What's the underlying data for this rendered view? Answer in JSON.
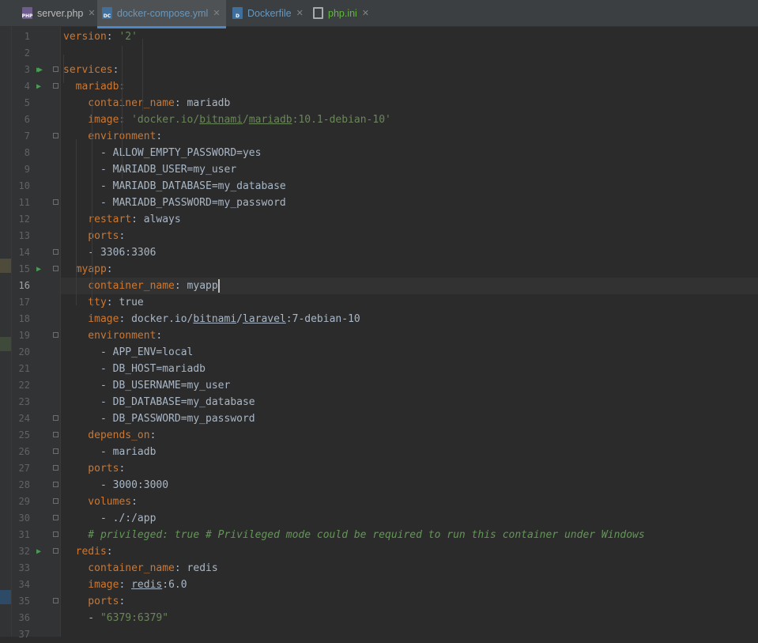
{
  "tabs": [
    {
      "label": "server.php",
      "icon": "php-file-icon",
      "icon_text": "PHP",
      "color": "#bbbbbb",
      "active": false
    },
    {
      "label": "docker-compose.yml",
      "icon": "docker-compose-file-icon",
      "icon_text": "DC",
      "color": "#6897bb",
      "active": true
    },
    {
      "label": "Dockerfile",
      "icon": "dockerfile-icon",
      "icon_text": "D",
      "color": "#6897bb",
      "active": false
    },
    {
      "label": "php.ini",
      "icon": "ini-file-icon",
      "icon_text": "",
      "color": "#62b543",
      "active": false
    }
  ],
  "close_glyph": "✕",
  "run_glyph": "▶",
  "colors": {
    "keyword": "#cc7832",
    "string": "#6a8759",
    "comment": "#629755",
    "text": "#a9b7c6",
    "accent": "#4a88c7"
  },
  "current_line": 16,
  "lines": [
    {
      "n": "1",
      "tokens": [
        {
          "t": "version",
          "c": "k"
        },
        {
          "t": ": ",
          "c": "v"
        },
        {
          "t": "'2'",
          "c": "s"
        }
      ]
    },
    {
      "n": "2",
      "tokens": []
    },
    {
      "n": "3",
      "run": "double",
      "tokens": [
        {
          "t": "services",
          "c": "k"
        },
        {
          "t": ":",
          "c": "v"
        }
      ]
    },
    {
      "n": "4",
      "run": "single",
      "tokens": [
        {
          "t": "  mariadb",
          "c": "k"
        },
        {
          "t": ":",
          "c": "v"
        }
      ]
    },
    {
      "n": "5",
      "tokens": [
        {
          "t": "    container_name",
          "c": "k"
        },
        {
          "t": ": mariadb",
          "c": "v"
        }
      ]
    },
    {
      "n": "6",
      "tokens": [
        {
          "t": "    image",
          "c": "k"
        },
        {
          "t": ": ",
          "c": "v"
        },
        {
          "t": "'docker.io/",
          "c": "s"
        },
        {
          "t": "bitnami",
          "c": "s u"
        },
        {
          "t": "/",
          "c": "s"
        },
        {
          "t": "mariadb",
          "c": "s u"
        },
        {
          "t": ":10.1-debian-10'",
          "c": "s"
        }
      ]
    },
    {
      "n": "7",
      "tokens": [
        {
          "t": "    environment",
          "c": "k"
        },
        {
          "t": ":",
          "c": "v"
        }
      ]
    },
    {
      "n": "8",
      "tokens": [
        {
          "t": "      - ALLOW_EMPTY_PASSWORD=yes",
          "c": "v"
        }
      ]
    },
    {
      "n": "9",
      "tokens": [
        {
          "t": "      - MARIADB_USER=my_user",
          "c": "v"
        }
      ]
    },
    {
      "n": "10",
      "tokens": [
        {
          "t": "      - MARIADB_DATABASE=my_database",
          "c": "v"
        }
      ]
    },
    {
      "n": "11",
      "tokens": [
        {
          "t": "      - MARIADB_PASSWORD=my_password",
          "c": "v"
        }
      ]
    },
    {
      "n": "12",
      "tokens": [
        {
          "t": "    restart",
          "c": "k"
        },
        {
          "t": ": always",
          "c": "v"
        }
      ]
    },
    {
      "n": "13",
      "tokens": [
        {
          "t": "    ports",
          "c": "k"
        },
        {
          "t": ":",
          "c": "v"
        }
      ]
    },
    {
      "n": "14",
      "tokens": [
        {
          "t": "    - 3306:3306",
          "c": "v"
        }
      ]
    },
    {
      "n": "15",
      "run": "single",
      "tokens": [
        {
          "t": "  myapp",
          "c": "k"
        },
        {
          "t": ":",
          "c": "v"
        }
      ]
    },
    {
      "n": "16",
      "tokens": [
        {
          "t": "    container_name",
          "c": "k"
        },
        {
          "t": ": myapp",
          "c": "v"
        }
      ]
    },
    {
      "n": "17",
      "tokens": [
        {
          "t": "    tty",
          "c": "k"
        },
        {
          "t": ": true",
          "c": "v"
        }
      ]
    },
    {
      "n": "18",
      "tokens": [
        {
          "t": "    image",
          "c": "k"
        },
        {
          "t": ": docker.io/",
          "c": "v"
        },
        {
          "t": "bitnami",
          "c": "v u"
        },
        {
          "t": "/",
          "c": "v"
        },
        {
          "t": "laravel",
          "c": "v u"
        },
        {
          "t": ":7-debian-10",
          "c": "v"
        }
      ]
    },
    {
      "n": "19",
      "tokens": [
        {
          "t": "    environment",
          "c": "k"
        },
        {
          "t": ":",
          "c": "v"
        }
      ]
    },
    {
      "n": "20",
      "tokens": [
        {
          "t": "      - APP_ENV=local",
          "c": "v"
        }
      ]
    },
    {
      "n": "21",
      "tokens": [
        {
          "t": "      - DB_HOST=mariadb",
          "c": "v"
        }
      ]
    },
    {
      "n": "22",
      "tokens": [
        {
          "t": "      - DB_USERNAME=my_user",
          "c": "v"
        }
      ]
    },
    {
      "n": "23",
      "tokens": [
        {
          "t": "      - DB_DATABASE=my_database",
          "c": "v"
        }
      ]
    },
    {
      "n": "24",
      "tokens": [
        {
          "t": "      - DB_PASSWORD=my_password",
          "c": "v"
        }
      ]
    },
    {
      "n": "25",
      "tokens": [
        {
          "t": "    depends_on",
          "c": "k"
        },
        {
          "t": ":",
          "c": "v"
        }
      ]
    },
    {
      "n": "26",
      "tokens": [
        {
          "t": "      - mariadb",
          "c": "v"
        }
      ]
    },
    {
      "n": "27",
      "tokens": [
        {
          "t": "    ports",
          "c": "k"
        },
        {
          "t": ":",
          "c": "v"
        }
      ]
    },
    {
      "n": "28",
      "tokens": [
        {
          "t": "      - 3000:3000",
          "c": "v"
        }
      ]
    },
    {
      "n": "29",
      "tokens": [
        {
          "t": "    volumes",
          "c": "k"
        },
        {
          "t": ":",
          "c": "v"
        }
      ]
    },
    {
      "n": "30",
      "tokens": [
        {
          "t": "      - ./:/app",
          "c": "v"
        }
      ]
    },
    {
      "n": "31",
      "tokens": [
        {
          "t": "    # privileged: true # Privileged mode could be required to run this container under Windows",
          "c": "c"
        }
      ]
    },
    {
      "n": "32",
      "run": "single",
      "tokens": [
        {
          "t": "  redis",
          "c": "k"
        },
        {
          "t": ":",
          "c": "v"
        }
      ]
    },
    {
      "n": "33",
      "tokens": [
        {
          "t": "    container_name",
          "c": "k"
        },
        {
          "t": ": redis",
          "c": "v"
        }
      ]
    },
    {
      "n": "34",
      "tokens": [
        {
          "t": "    image",
          "c": "k"
        },
        {
          "t": ": ",
          "c": "v"
        },
        {
          "t": "redis",
          "c": "v u"
        },
        {
          "t": ":6.0",
          "c": "v"
        }
      ]
    },
    {
      "n": "35",
      "tokens": [
        {
          "t": "    ports",
          "c": "k"
        },
        {
          "t": ":",
          "c": "v"
        }
      ]
    },
    {
      "n": "36",
      "tokens": [
        {
          "t": "    - ",
          "c": "v"
        },
        {
          "t": "\"6379:6379\"",
          "c": "s"
        }
      ]
    },
    {
      "n": "37",
      "tokens": []
    }
  ]
}
